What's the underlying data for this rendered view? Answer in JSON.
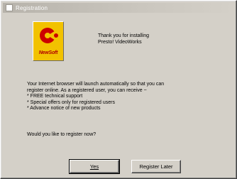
{
  "window": {
    "title": "Registration"
  },
  "logo": {
    "brand": "NewSoft",
    "colors": {
      "background": "#f2c200",
      "mark": "#cc0000",
      "text": "#b00000"
    }
  },
  "header": {
    "line1": "Thank you for installing",
    "line2": "Presto! VideoWorks"
  },
  "body": {
    "line1": "Your Internet browser will launch automatically so that you can",
    "line2": "register online. As a registered user, you can receive ~",
    "bullet1": "* FREE technical support",
    "bullet2": "* Special offers only for registered users",
    "bullet3": "* Advance notice of new products"
  },
  "question": "Would you like to register now?",
  "buttons": {
    "yes_label": "Yes",
    "later_label": "Register Later"
  }
}
